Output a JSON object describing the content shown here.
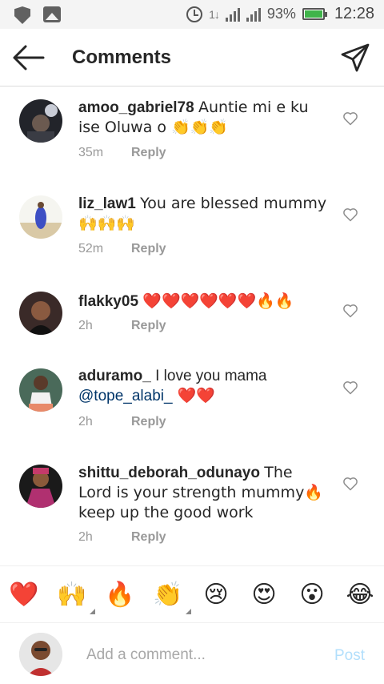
{
  "status_bar": {
    "battery_pct": "93%",
    "battery_level": 0.93,
    "time": "12:28",
    "network": "1↓",
    "icons": [
      "shield-icon",
      "gallery-icon",
      "alarm-icon",
      "signal-icon",
      "battery-icon"
    ]
  },
  "header": {
    "title": "Comments",
    "back_icon": "arrow-left-icon",
    "send_icon": "paper-plane-icon"
  },
  "comments": [
    {
      "username": "amoo_gabriel78",
      "text": "Auntie mi e ku ise Oluwa o 👏👏👏",
      "mention": "",
      "text_after": "",
      "time": "35m",
      "reply": "Reply"
    },
    {
      "username": "liz_law1",
      "text": "You are blessed mummy 🙌🙌🙌",
      "mention": "",
      "text_after": "",
      "time": "52m",
      "reply": "Reply"
    },
    {
      "username": "flakky05",
      "text": "❤️❤️❤️❤️❤️❤️🔥🔥",
      "mention": "",
      "text_after": "",
      "time": "2h",
      "reply": "Reply"
    },
    {
      "username": "aduramo_",
      "text": "I love you mama",
      "mention": "@tope_alabi_",
      "text_after": " ❤️❤️",
      "time": "2h",
      "reply": "Reply"
    },
    {
      "username": "shittu_deborah_odunayo",
      "text": "The Lord is your strength mummy🔥 keep up the good work",
      "mention": "",
      "text_after": "",
      "time": "2h",
      "reply": "Reply"
    }
  ],
  "reactions": [
    "❤️",
    "🙌",
    "🔥",
    "👏",
    "😢",
    "😍",
    "😮",
    "😂"
  ],
  "input": {
    "placeholder": "Add a comment...",
    "post_label": "Post"
  },
  "colors": {
    "link": "#003569",
    "meta_gray": "#999999",
    "post_disabled": "#b2dffc"
  }
}
